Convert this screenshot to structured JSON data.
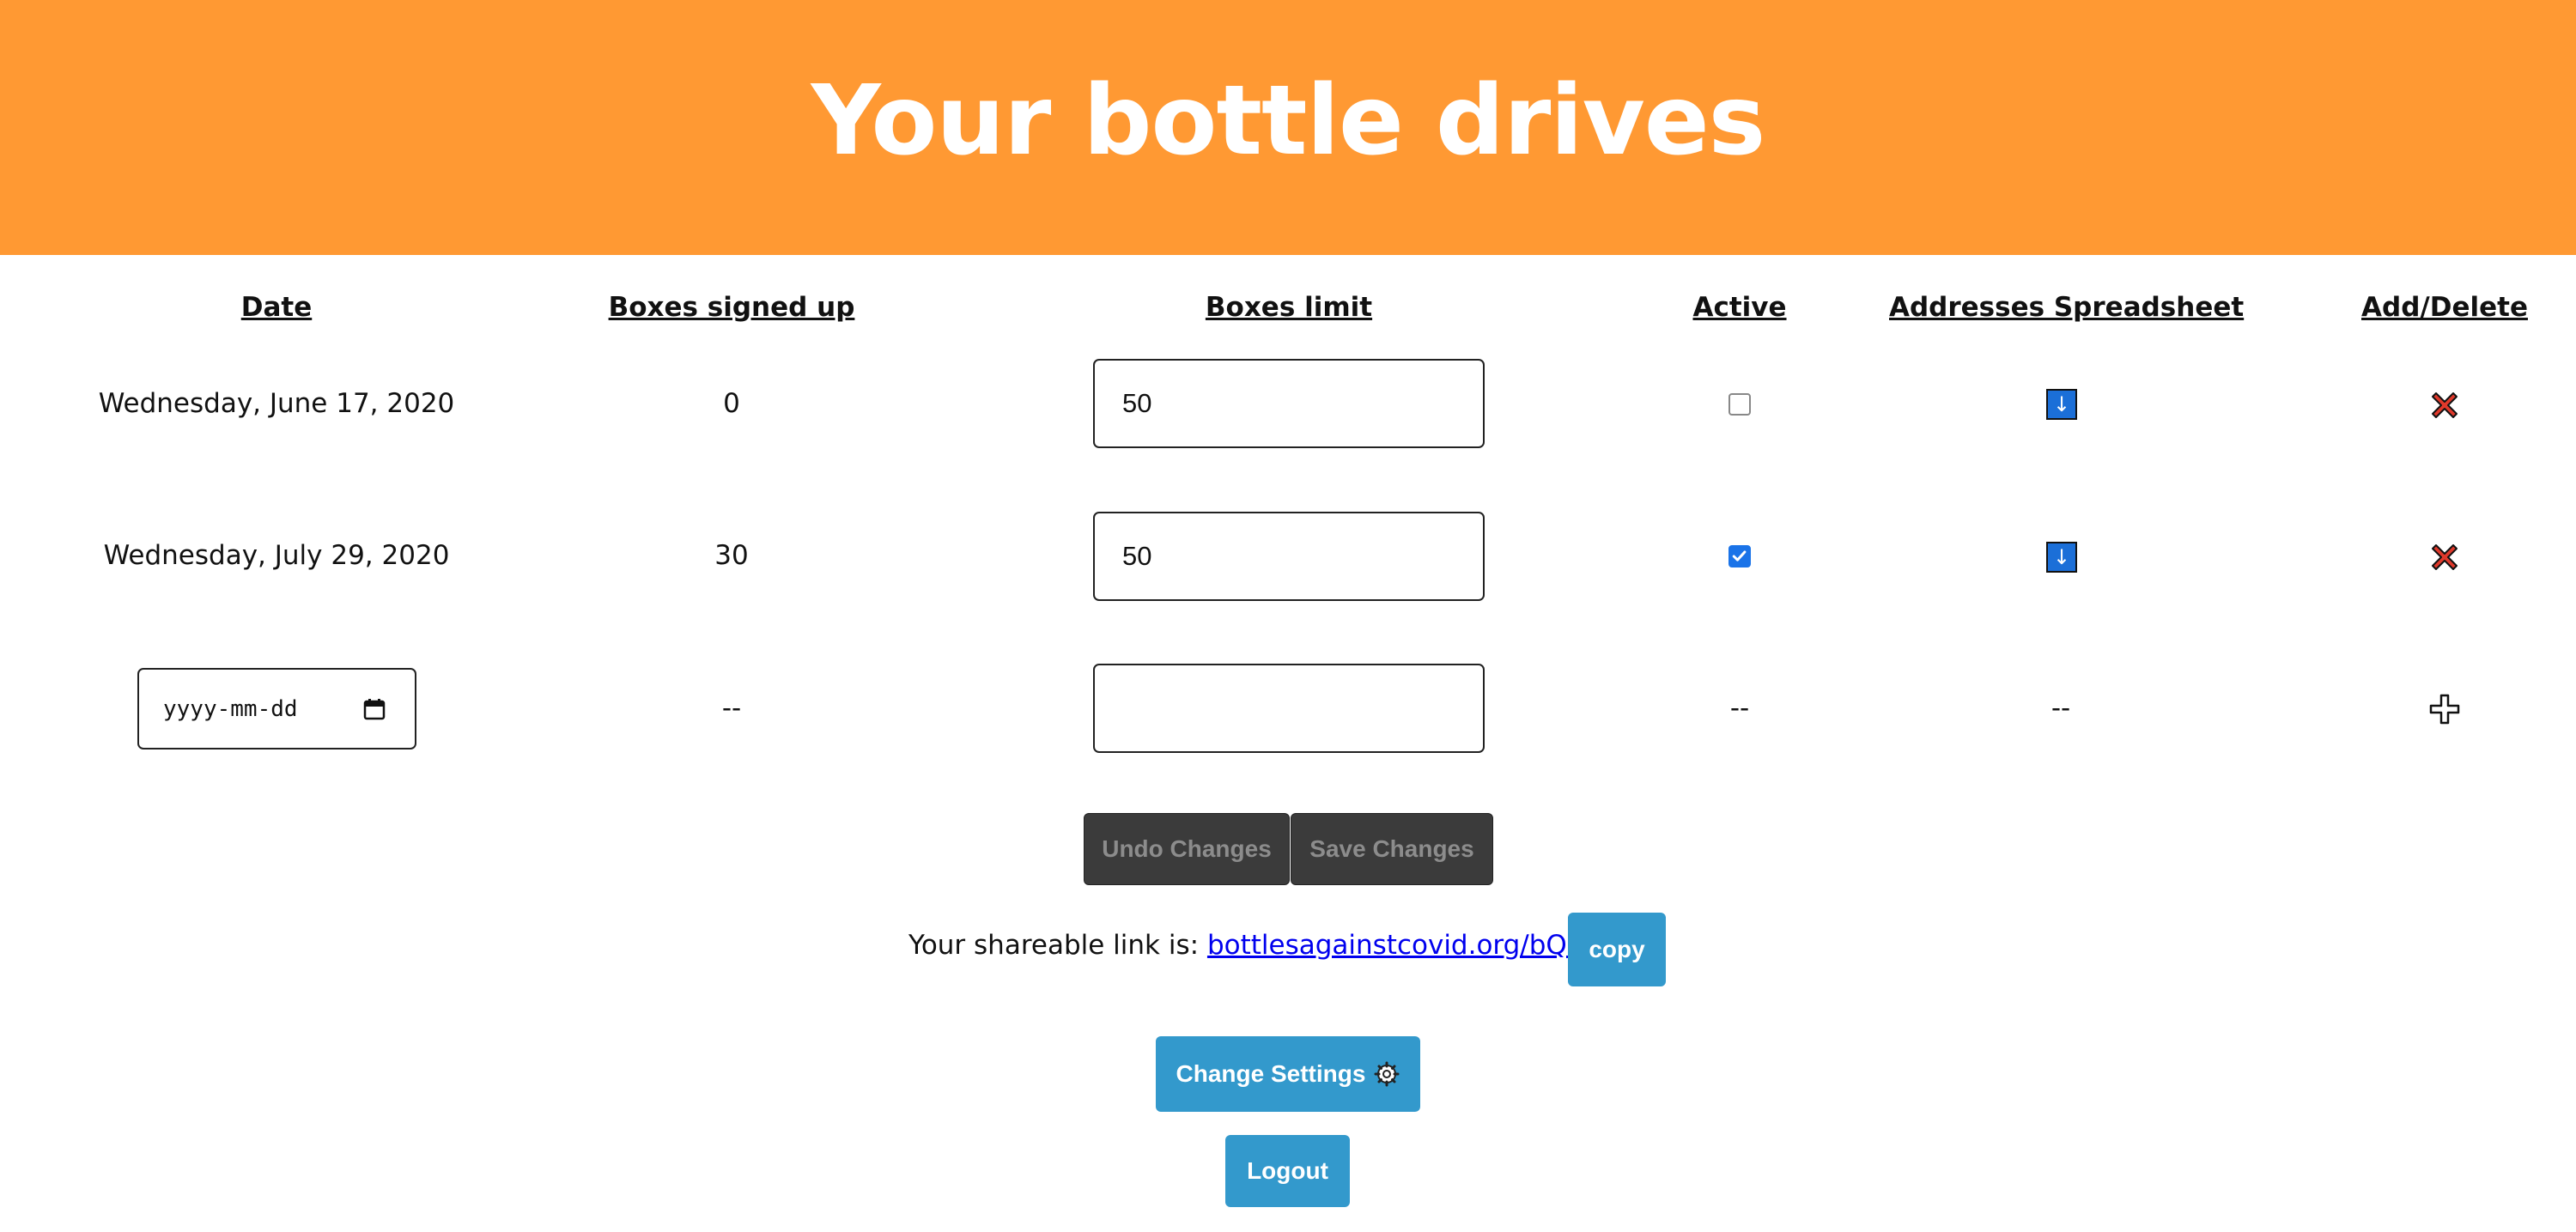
{
  "header": {
    "title": "Your bottle drives"
  },
  "table": {
    "columns": [
      "Date",
      "Boxes signed up",
      "Boxes limit",
      "Active",
      "Addresses Spreadsheet",
      "Add/Delete"
    ],
    "rows": [
      {
        "date": "Wednesday, June 17, 2020",
        "boxes_signed_up": "0",
        "boxes_limit": "50",
        "active": false
      },
      {
        "date": "Wednesday, July 29, 2020",
        "boxes_signed_up": "30",
        "boxes_limit": "50",
        "active": true
      }
    ],
    "new_row": {
      "date_placeholder": "yyyy-mm-dd",
      "boxes_signed_up": "--",
      "boxes_limit": "",
      "active": "--",
      "spreadsheet": "--"
    }
  },
  "icons": {
    "download": "download-icon",
    "delete": "delete-x-icon",
    "add": "add-plus-icon",
    "calendar": "calendar-icon",
    "gear": "gear-icon"
  },
  "actions": {
    "undo_label": "Undo Changes",
    "save_label": "Save Changes",
    "copy_label": "copy",
    "change_settings_label": "Change Settings",
    "logout_label": "Logout"
  },
  "share": {
    "prefix": "Your shareable link is:",
    "link": "bottlesagainstcovid.org/bQsPW"
  },
  "colors": {
    "header_bg": "#ff9933",
    "primary_button": "#3399cc",
    "disabled_button": "#3b3b3b",
    "delete_red": "#e0392b",
    "download_blue": "#1b6fd8"
  }
}
